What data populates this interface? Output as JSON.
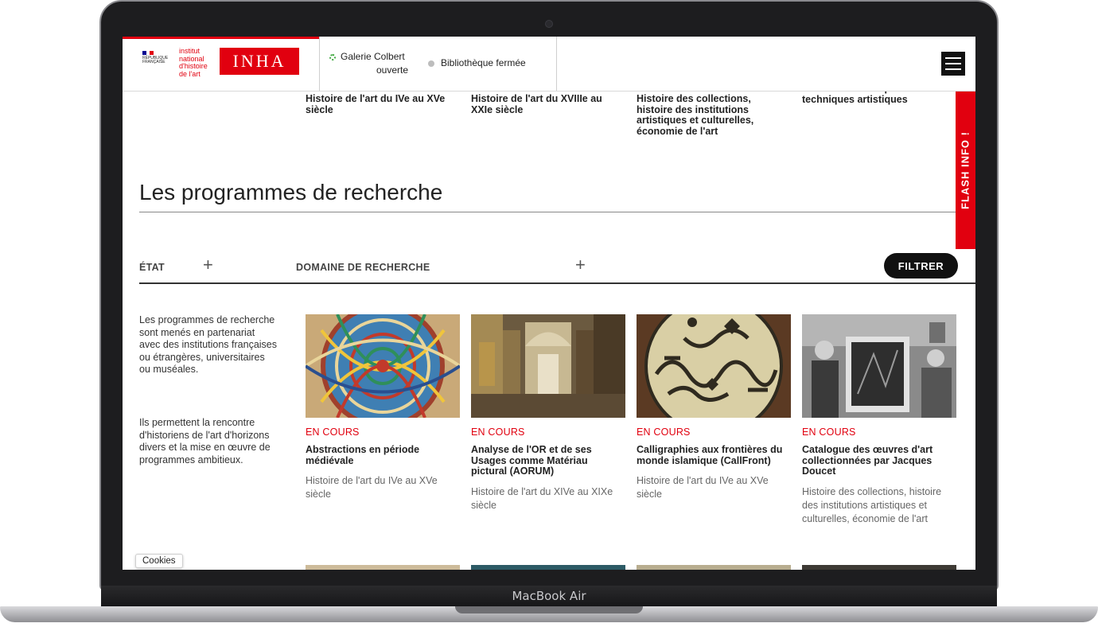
{
  "device": {
    "label": "MacBook Air"
  },
  "header": {
    "republic_text": "RÉPUBLIQUE FRANÇAISE",
    "institute_name": "institut national d'histoire de l'art",
    "logo_text": "INHA",
    "status_galerie_line1": "Galerie Colbert",
    "status_galerie_line2": "ouverte",
    "status_bibliotheque": "Bibliothèque fermée",
    "menu_icon": "hamburger-menu-icon"
  },
  "flash_info": "FLASH INFO !",
  "top_categories": [
    "Histoire de l'art du IVe au XVe siècle",
    "Histoire de l'art du XVIIIe au XXIe siècle",
    "Histoire des collections, histoire des institutions artistiques et culturelles, économie de l'art",
    "Histoire des disciplines et des techniques artistiques"
  ],
  "section": {
    "title": "Les programmes de recherche"
  },
  "filters": {
    "etat_label": "ÉTAT",
    "domaine_label": "DOMAINE DE RECHERCHE",
    "filter_button": "FILTRER"
  },
  "intro": {
    "paragraph1": "Les programmes de recherche sont menés en partenariat avec des institutions françaises ou étrangères, universitaires ou muséales.",
    "paragraph2": "Ils permettent la rencontre d'historiens de l'art d'horizons divers et la mise en œuvre de programmes ambitieux."
  },
  "cards": [
    {
      "status": "EN COURS",
      "title": "Abstractions en période médiévale",
      "domain": "Histoire de l'art du IVe au XVe siècle"
    },
    {
      "status": "EN COURS",
      "title": "Analyse de l'OR et de ses Usages comme Matériau pictural (AORUM)",
      "domain": "Histoire de l'art du XIVe au XIXe siècle"
    },
    {
      "status": "EN COURS",
      "title": "Calligraphies aux frontières du monde islamique (CallFront)",
      "domain": "Histoire de l'art du IVe au XVe siècle"
    },
    {
      "status": "EN COURS",
      "title": "Catalogue des œuvres d'art collectionnées par Jacques Doucet",
      "domain": "Histoire des collections, histoire des institutions artistiques et culturelles, économie de l'art"
    }
  ],
  "cookies_label": "Cookies"
}
